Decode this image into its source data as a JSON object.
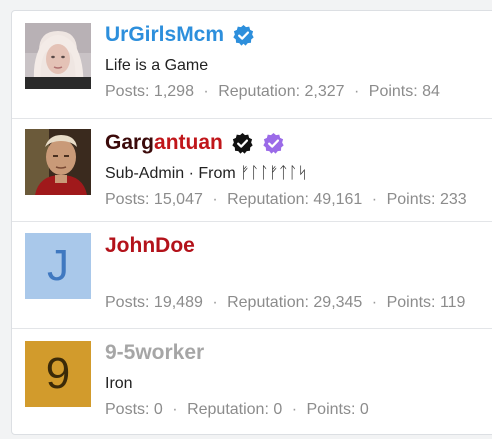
{
  "members": [
    {
      "username": "UrGirlsMcm",
      "username_color": "#2d8fdc",
      "badges": [
        "verified-blue-icon"
      ],
      "subtitle": "Life is a Game",
      "posts_label": "Posts:",
      "posts": "1,298",
      "reputation_label": "Reputation:",
      "reputation": "2,327",
      "points_label": "Points:",
      "points": "84",
      "avatar": {
        "type": "photo",
        "icon": "blonde-girl-avatar"
      }
    },
    {
      "username": "Gargantuan",
      "username_color_primary": "#3b0a0a",
      "username_color_accent": "#c0161a",
      "username_part1": "Garg",
      "username_part2": "antuan",
      "badges": [
        "verified-black-icon",
        "verified-purple-icon"
      ],
      "subtitle": "Sub-Admin · From ᚠᛚᛚᚠᛏᛚᛋ",
      "posts_label": "Posts:",
      "posts": "15,047",
      "reputation_label": "Reputation:",
      "reputation": "49,161",
      "points_label": "Points:",
      "points": "233",
      "avatar": {
        "type": "photo",
        "icon": "soldier-man-avatar"
      }
    },
    {
      "username": "JohnDoe",
      "username_color": "#b3121a",
      "badges": [],
      "subtitle": "",
      "posts_label": "Posts:",
      "posts": "19,489",
      "reputation_label": "Reputation:",
      "reputation": "29,345",
      "points_label": "Points:",
      "points": "119",
      "avatar": {
        "type": "letter",
        "letter": "J",
        "bg": "#a9c8ea",
        "fg": "#3f78c0"
      }
    },
    {
      "username": "9-5worker",
      "username_color": "#a6a6a6",
      "badges": [],
      "subtitle": "Iron",
      "posts_label": "Posts:",
      "posts": "0",
      "reputation_label": "Reputation:",
      "reputation": "0",
      "points_label": "Points:",
      "points": "0",
      "avatar": {
        "type": "letter",
        "letter": "9",
        "bg": "#d29b2c",
        "fg": "#3b2a08"
      }
    }
  ],
  "separator": "·"
}
